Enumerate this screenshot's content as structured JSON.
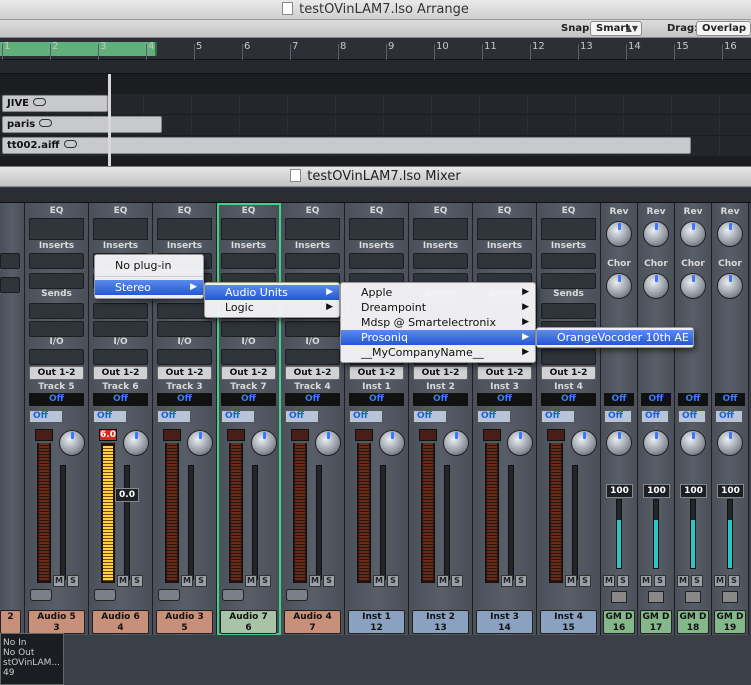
{
  "arrange": {
    "title": "testOVinLAM7.lso Arrange",
    "snap_label": "Snap:",
    "snap_value": "Smart",
    "drag_label": "Drag:",
    "drag_value": "Overlap"
  },
  "ruler": {
    "ticks": [
      "1",
      "2",
      "3",
      "4",
      "5",
      "6",
      "7",
      "8",
      "9",
      "10",
      "11",
      "12",
      "13",
      "14",
      "15",
      "16"
    ]
  },
  "regions": [
    {
      "name": "JIVE"
    },
    {
      "name": "paris"
    },
    {
      "name": "tt002.aiff"
    }
  ],
  "mixer": {
    "title": "testOVinLAM7.lso Mixer",
    "labels": {
      "eq": "EQ",
      "inserts": "Inserts",
      "sends": "Sends",
      "io": "I/O",
      "off": "Off",
      "rev": "Rev",
      "chor": "Chor"
    },
    "strips": [
      {
        "out": "Out 1-2",
        "track": "Track 5",
        "name": "Audio 5",
        "num": "3",
        "kind": "audio"
      },
      {
        "out": "Out 1-2",
        "track": "Track 6",
        "name": "Audio 6",
        "num": "4",
        "kind": "audio",
        "peak": "6.0",
        "fader": "0.0"
      },
      {
        "out": "Out 1-2",
        "track": "Track 3",
        "name": "Audio 3",
        "num": "5",
        "kind": "audio"
      },
      {
        "out": "Out 1-2",
        "track": "Track 7",
        "name": "Audio 7",
        "num": "6",
        "kind": "audio",
        "selected": true
      },
      {
        "out": "Out 1-2",
        "track": "Track 4",
        "name": "Audio 4",
        "num": "7",
        "kind": "audio"
      },
      {
        "out": "Out 1-2",
        "track": "Inst 1",
        "name": "Inst 1",
        "num": "12",
        "kind": "inst"
      },
      {
        "out": "Out 1-2",
        "track": "Inst 2",
        "name": "Inst 2",
        "num": "13",
        "kind": "inst"
      },
      {
        "out": "Out 1-2",
        "track": "Inst 3",
        "name": "Inst 3",
        "num": "14",
        "kind": "inst"
      },
      {
        "out": "Out 1-2",
        "track": "Inst 4",
        "name": "Inst 4",
        "num": "15",
        "kind": "inst"
      }
    ],
    "gm": [
      {
        "name": "GM D",
        "num": "16",
        "vol": "100"
      },
      {
        "name": "GM D",
        "num": "17",
        "vol": "100"
      },
      {
        "name": "GM D",
        "num": "18",
        "vol": "100"
      },
      {
        "name": "GM D",
        "num": "19",
        "vol": "100"
      }
    ],
    "left_partial": {
      "track": "2",
      "name": "2"
    }
  },
  "menus": {
    "plugin": {
      "no_plugin": "No plug-in",
      "stereo": "Stereo"
    },
    "stereo": {
      "audio_units": "Audio Units",
      "logic": "Logic"
    },
    "audio_units": {
      "items": [
        "Apple",
        "Dreampoint",
        "Mdsp @ Smartelectronix",
        "Prosoniq",
        "__MyCompanyName__"
      ]
    },
    "prosoniq": {
      "item": "OrangeVocoder 10th AE"
    }
  },
  "tooltip": {
    "l1": "No In",
    "l2": "No Out",
    "l3": "stOVinLAM...",
    "l4": "49"
  }
}
